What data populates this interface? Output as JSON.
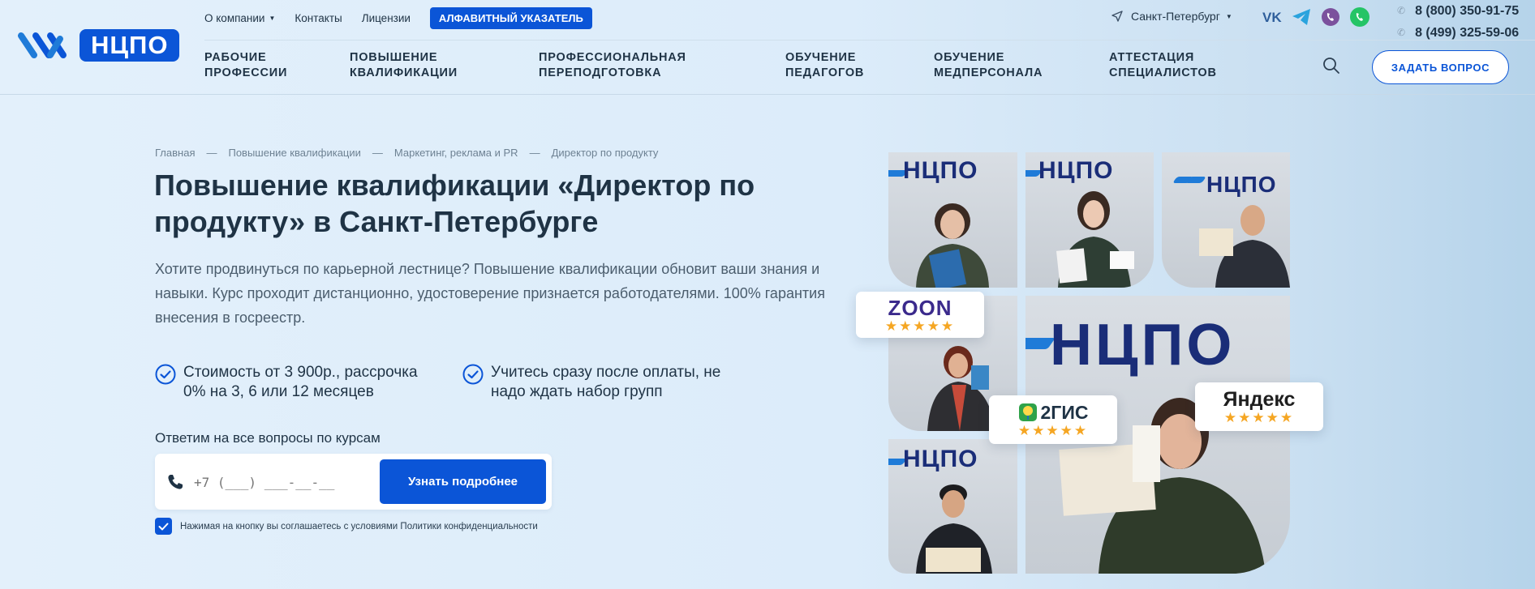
{
  "logo": {
    "text": "НЦПО"
  },
  "topnav": {
    "about": "О компании",
    "contacts": "Контакты",
    "licenses": "Лицензии",
    "alphabet": "АЛФАВИТНЫЙ УКАЗАТЕЛЬ"
  },
  "city": {
    "name": "Санкт-Петербург"
  },
  "socials": [
    "vk-icon",
    "telegram-icon",
    "viber-icon",
    "whatsapp-icon"
  ],
  "phones": [
    "8 (800) 350-91-75",
    "8 (499) 325-59-06"
  ],
  "mainnav": {
    "items": [
      "РАБОЧИЕ\nПРОФЕССИИ",
      "ПОВЫШЕНИЕ\nКВАЛИФИКАЦИИ",
      "ПРОФЕССИОНАЛЬНАЯ\nПЕРЕПОДГОТОВКА",
      "ОБУЧЕНИЕ\nПЕДАГОГОВ",
      "ОБУЧЕНИЕ\nМЕДПЕРСОНАЛА",
      "АТТЕСТАЦИЯ\nСПЕЦИАЛИСТОВ"
    ],
    "ask": "ЗАДАТЬ ВОПРОС"
  },
  "breadcrumb": [
    "Главная",
    "Повышение квалификации",
    "Маркетинг, реклама и PR",
    "Директор по продукту"
  ],
  "breadcrumb_sep": "—",
  "hero": {
    "title": "Повышение квалификации «Директор по продукту» в Санкт-Петербурге",
    "lead": "Хотите продвинуться по карьерной лестнице? Повышение квалификации обновит ваши знания и навыки. Курс проходит дистанционно, удостоверение признается работодателями. 100% гарантия внесения в госреестр.",
    "features": [
      "Стоимость от 3 900р., рассрочка 0% на 3, 6 или 12 месяцев",
      "Учитесь сразу после оплаты, не надо ждать набор групп"
    ],
    "answer": "Ответим на все вопросы по курсам",
    "phone_placeholder": "+7 (___) ___-__-__",
    "submit": "Узнать подробнее",
    "agree": "Нажимая на кнопку вы соглашаетесь с условиями Политики конфиденциальности"
  },
  "badges": {
    "zoon": "ZOON",
    "gis": "2ГИС",
    "yandex": "Яндекс",
    "stars": "★★★★★"
  },
  "colors": {
    "accent": "#0b55d7",
    "text": "#1f3345",
    "star": "#f5a623"
  }
}
